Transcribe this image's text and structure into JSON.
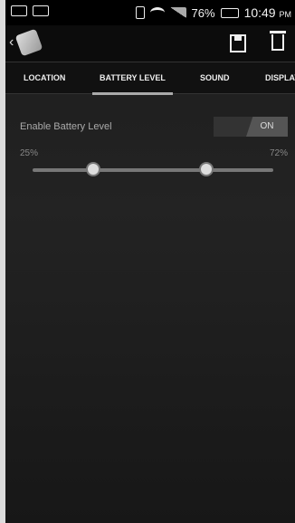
{
  "status": {
    "battery": "76%",
    "time": "10:49",
    "ampm": "PM"
  },
  "tabs": [
    {
      "label": "LOCATION"
    },
    {
      "label": "BATTERY LEVEL"
    },
    {
      "label": "SOUND"
    },
    {
      "label": "DISPLAY"
    }
  ],
  "settings": {
    "enable_label": "Enable Battery Level",
    "toggle_text": "ON",
    "min_text": "25%",
    "max_text": "72%",
    "range": {
      "low": 25,
      "high": 72,
      "scale_min": 0,
      "scale_max": 100
    }
  },
  "icons": [
    "back-icon",
    "app-icon",
    "save-icon",
    "trash-icon"
  ],
  "colors": {
    "background": "#1e1e1e",
    "tab_bar": "#111111",
    "accent": "#aaaaaa"
  }
}
